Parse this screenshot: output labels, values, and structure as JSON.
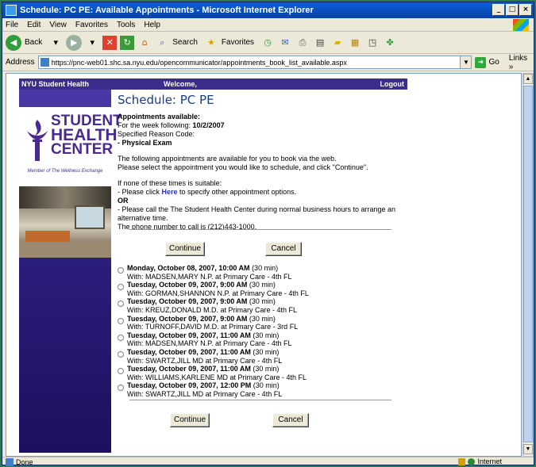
{
  "window": {
    "title": "Schedule: PC PE: Available Appointments - Microsoft Internet Explorer",
    "controls": [
      "_",
      "□",
      "×"
    ]
  },
  "menu": [
    "File",
    "Edit",
    "View",
    "Favorites",
    "Tools",
    "Help"
  ],
  "toolbar": {
    "back": "Back",
    "search": "Search",
    "favorites": "Favorites"
  },
  "address": {
    "label": "Address",
    "url": "https://pnc-web01.shc.sa.nyu.edu/opencommunicator/appointments_book_list_available.aspx",
    "go": "Go",
    "links": "Links »"
  },
  "status": {
    "text": "Done",
    "zone": "Internet"
  },
  "banner": {
    "site": "NYU Student Health",
    "welcome": "Welcome,",
    "logout": "Logout"
  },
  "logo": {
    "line1": "STUDENT",
    "line2": "HEALTH",
    "line3": "CENTER",
    "tagline": "Member of The Wellness Exchange"
  },
  "page": {
    "title": "Schedule: PC PE",
    "available_heading": "Appointments available:",
    "week_label": "For the week following: ",
    "week_value": "10/2/2007",
    "reason_label": "Specified Reason Code:",
    "reason_value": "- Physical Exam",
    "intro1": "The following appointments are available for you to book via the web.",
    "intro2": "Please select the appointment you would like to schedule, and click \"Continue\".",
    "none_suitable": "If none of these times is suitable:",
    "click_prefix": "- Please click ",
    "click_link": "Here",
    "click_suffix": " to specify other appointment options.",
    "or": "OR",
    "call": "- Please call the The Student Health Center during normal business hours to arrange an alternative time.",
    "phone": "The phone number to call is (212)443-1000.",
    "continue": "Continue",
    "cancel": "Cancel"
  },
  "appointments": [
    {
      "when": "Monday, October 08, 2007, 10:00 AM",
      "dur": " (30 min)",
      "with": "With: MADSEN,MARY N.P. at Primary Care - 4th FL"
    },
    {
      "when": "Tuesday, October 09, 2007, 9:00 AM",
      "dur": " (30 min)",
      "with": "With: GORMAN,SHANNON N.P. at Primary Care - 4th FL"
    },
    {
      "when": "Tuesday, October 09, 2007, 9:00 AM",
      "dur": " (30 min)",
      "with": "With: KREUZ,DONALD M.D. at Primary Care - 4th FL"
    },
    {
      "when": "Tuesday, October 09, 2007, 9:00 AM",
      "dur": " (30 min)",
      "with": "With: TURNOFF,DAVID M.D. at Primary Care - 3rd FL"
    },
    {
      "when": "Tuesday, October 09, 2007, 11:00 AM",
      "dur": " (30 min)",
      "with": "With: MADSEN,MARY N.P. at Primary Care - 4th FL"
    },
    {
      "when": "Tuesday, October 09, 2007, 11:00 AM",
      "dur": " (30 min)",
      "with": "With: SWARTZ,JILL MD at Primary Care - 4th FL"
    },
    {
      "when": "Tuesday, October 09, 2007, 11:00 AM",
      "dur": " (30 min)",
      "with": "With: WILLIAMS,KARLENE MD at Primary Care - 4th FL"
    },
    {
      "when": "Tuesday, October 09, 2007, 12:00 PM",
      "dur": " (30 min)",
      "with": "With: SWARTZ,JILL MD at Primary Care - 4th FL"
    }
  ]
}
